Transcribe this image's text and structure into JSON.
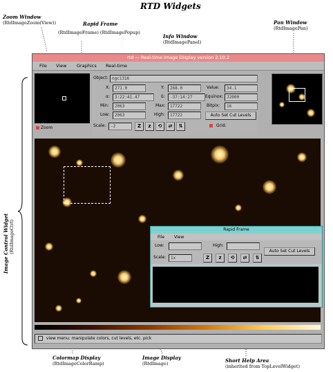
{
  "page_title": "RTD Widgets",
  "annotations": {
    "zoom": {
      "title": "Zoom Window",
      "sub": "(RtdImageZoom(View))"
    },
    "rapid": {
      "title": "Rapid Frame",
      "sub": "(RtdImageFrame) (RtdImagePopup)"
    },
    "info": {
      "title": "Info Window",
      "sub": "(RtdImagePanel)"
    },
    "pan": {
      "title": "Pan Window",
      "sub": "(RtdImagePan)"
    },
    "control": {
      "title": "Image Control Widget",
      "sub": "(RtdImageCtrl)"
    },
    "colormap": {
      "title": "Colormap Display",
      "sub": "(RtdImageColorRamp)"
    },
    "display": {
      "title": "Image Display",
      "sub": "(RtdImage)"
    },
    "help": {
      "title": "Short Help Area",
      "sub": "(inherited from TopLevelWidget)"
    }
  },
  "window": {
    "title": "rtd — Real-time Image Display  version 2.10.2",
    "menu": [
      "File",
      "View",
      "Graphics",
      "Real-time"
    ],
    "zoom_check_label": "Zoom",
    "help_text": "view menu: manipulate colors, cut levels, etc. pick"
  },
  "info_panel": {
    "object_label": "Object:",
    "object_value": "ngc1316",
    "x_label": "X:",
    "x_value": "271.0",
    "y_label": "Y:",
    "y_value": "268.0",
    "value_label": "Value:",
    "value_value": "34.1",
    "a_label": "α:",
    "a_value": "3:22:41.47",
    "d_label": "δ:",
    "d_value": "-37:14:27",
    "equinox_label": "Equinox:",
    "equinox_value": "J2000",
    "min_label": "Min:",
    "min_value": "2063",
    "max_label": "Max:",
    "max_value": "17722",
    "bitpix_label": "Bitpix:",
    "bitpix_value": "16",
    "low_label": "Low:",
    "low_value": "2063",
    "high_label": "High:",
    "high_value": "17722",
    "autoset_label": "Auto Set Cut Levels",
    "scale_label": "Scale:",
    "scale_value": "-2",
    "grid_label": "Grid:",
    "tool_buttons": [
      "Z",
      "z",
      "⟲",
      "⇄",
      "⇅"
    ]
  },
  "rapid_frame": {
    "title": "Rapid Frame",
    "menu": [
      "File",
      "View"
    ],
    "low_label": "Low:",
    "high_label": "High:",
    "scale_label": "Scale:",
    "scale_value": "1x",
    "autoset_label": "Auto Set Cut Levels",
    "tool_buttons": [
      "Z",
      "z",
      "⟲",
      "⇄",
      "⇅"
    ]
  },
  "colors": {
    "titlebar": "#e88a8a",
    "rapid_titlebar": "#7fd0d0",
    "image_bg": "#1a0c02"
  }
}
